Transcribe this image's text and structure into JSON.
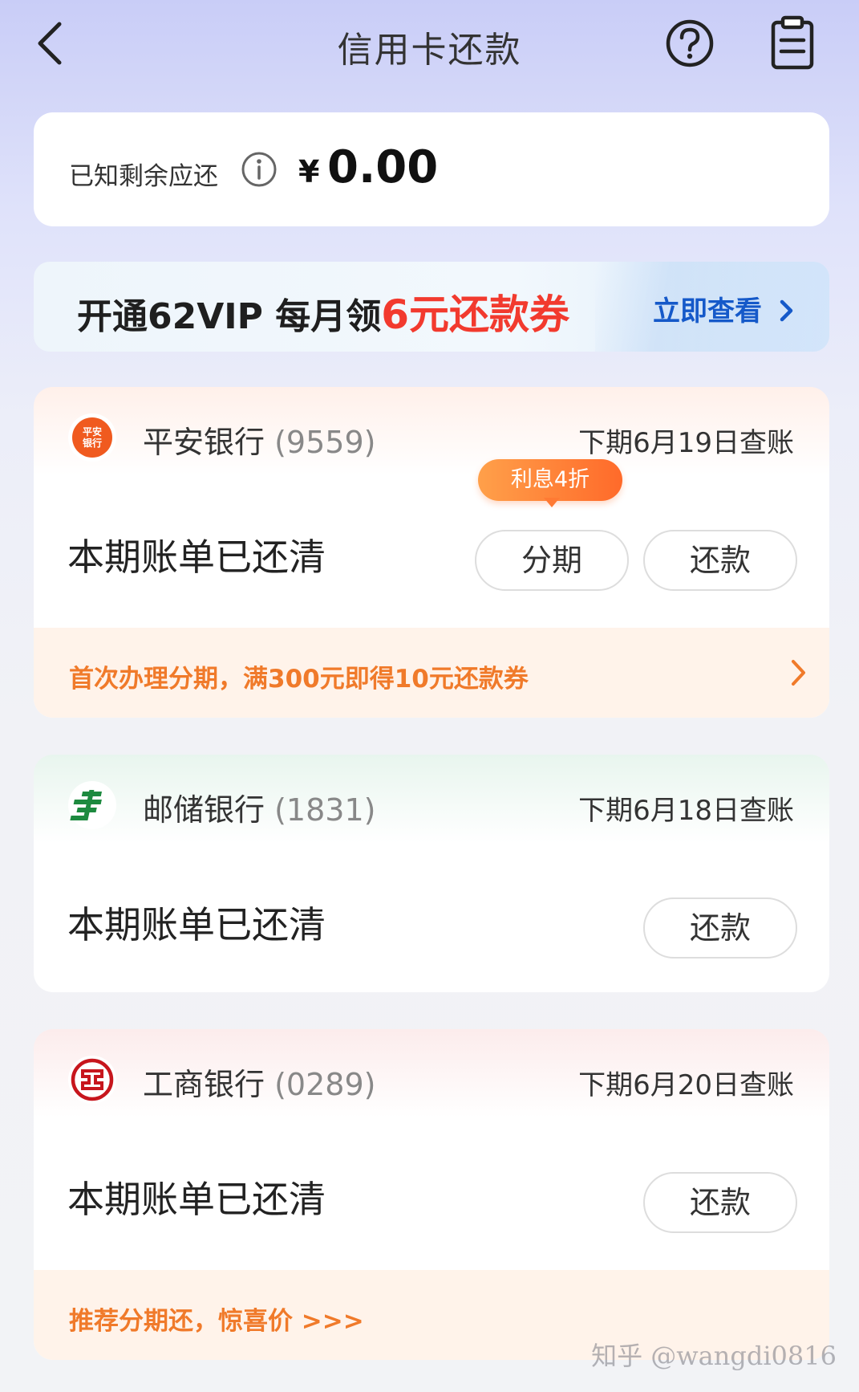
{
  "header": {
    "title": "信用卡还款"
  },
  "summary": {
    "label": "已知剩余应还",
    "currency": "¥",
    "amount": "0.00"
  },
  "banner": {
    "text_prefix": "开通62VIP 每月领",
    "text_highlight": "6元还款券",
    "cta": "立即查看"
  },
  "cards": [
    {
      "bank": "平安银行",
      "tail": "(9559)",
      "logo_text": "平安 银行",
      "next_date": "下期6月19日查账",
      "status": "本期账单已还清",
      "tag": "利息4折",
      "installment_label": "分期",
      "repay_label": "还款",
      "promo": "首次办理分期，满300元即得10元还款券"
    },
    {
      "bank": "邮储银行",
      "tail": "(1831)",
      "next_date": "下期6月18日查账",
      "status": "本期账单已还清",
      "repay_label": "还款"
    },
    {
      "bank": "工商银行",
      "tail": "(0289)",
      "next_date": "下期6月20日查账",
      "status": "本期账单已还清",
      "repay_label": "还款",
      "promo": "推荐分期还，惊喜价 >>>"
    }
  ],
  "watermark": "知乎 @wangdi0816",
  "icons": {
    "back": "chevron-left-icon",
    "help": "question-circle-icon",
    "bill": "clipboard-icon",
    "info": "info-circle-icon"
  },
  "colors": {
    "accent_red": "#f23a2e",
    "link_blue": "#1559c9",
    "promo_orange": "#f07a2a"
  }
}
